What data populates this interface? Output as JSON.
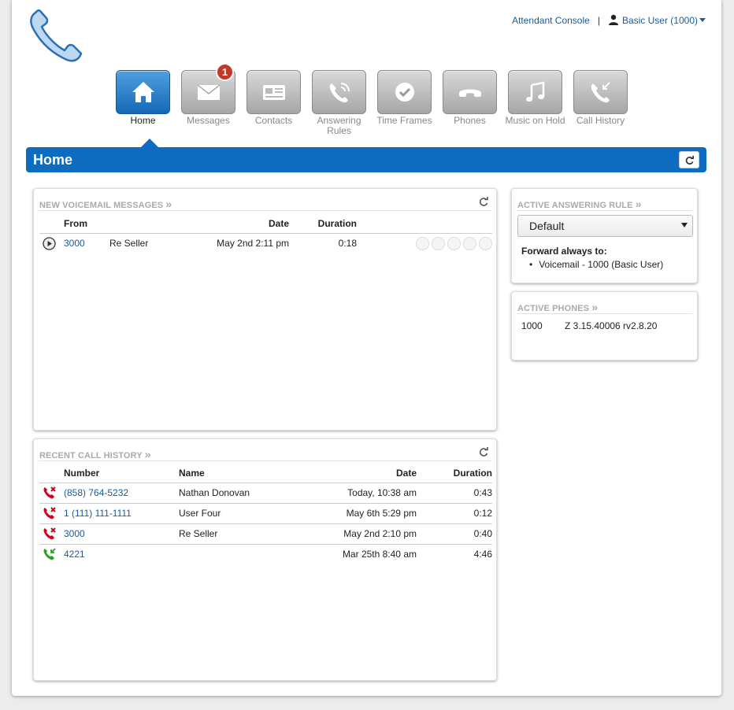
{
  "header": {
    "attendant_console": "Attendant Console",
    "separator": "|",
    "user_label": "Basic User (1000)"
  },
  "nav": {
    "items": [
      {
        "label": "Home",
        "icon": "home-icon",
        "active": true
      },
      {
        "label": "Messages",
        "icon": "envelope-icon",
        "badge": "1"
      },
      {
        "label": "Contacts",
        "icon": "contact-card-icon"
      },
      {
        "label": "Answering Rules",
        "icon": "answering-rules-icon"
      },
      {
        "label": "Time Frames",
        "icon": "clock-icon"
      },
      {
        "label": "Phones",
        "icon": "handset-icon"
      },
      {
        "label": "Music on Hold",
        "icon": "music-note-icon"
      },
      {
        "label": "Call History",
        "icon": "call-history-icon"
      }
    ]
  },
  "title": {
    "text": "Home"
  },
  "voicemail": {
    "title": "NEW VOICEMAIL MESSAGES",
    "columns": {
      "from": "From",
      "date": "Date",
      "duration": "Duration"
    },
    "rows": [
      {
        "number": "3000",
        "name": "Re Seller",
        "date": "May 2nd 2:11 pm",
        "duration": "0:18"
      }
    ]
  },
  "call_history": {
    "title": "RECENT CALL HISTORY",
    "columns": {
      "number": "Number",
      "name": "Name",
      "date": "Date",
      "duration": "Duration"
    },
    "rows": [
      {
        "number": "(858) 764-5232",
        "name": "Nathan Donovan",
        "date": "Today, 10:38 am",
        "duration": "0:43",
        "status": "missed",
        "color": "#d0021b"
      },
      {
        "number": "1 (111) 111-1111",
        "name": "User Four",
        "date": "May 6th 5:29 pm",
        "duration": "0:12",
        "status": "missed",
        "color": "#d0021b"
      },
      {
        "number": "3000",
        "name": "Re Seller",
        "date": "May 2nd 2:10 pm",
        "duration": "0:40",
        "status": "missed",
        "color": "#d0021b"
      },
      {
        "number": "4221",
        "name": "",
        "date": "Mar 25th 8:40 am",
        "duration": "4:46",
        "status": "outgoing",
        "color": "#2e9e2e"
      }
    ]
  },
  "answering_rule": {
    "title": "ACTIVE ANSWERING RULE",
    "selected": "Default",
    "forward_label": "Forward always to:",
    "forward_target": "Voicemail - 1000 (Basic User)"
  },
  "active_phones": {
    "title": "ACTIVE PHONES",
    "rows": [
      {
        "extension": "1000",
        "model": "Z 3.15.40006 rv2.8.20"
      }
    ]
  },
  "colors": {
    "brand_blue": "#0d6cc0",
    "link": "#1a5a9a",
    "badge": "#c0392b"
  }
}
